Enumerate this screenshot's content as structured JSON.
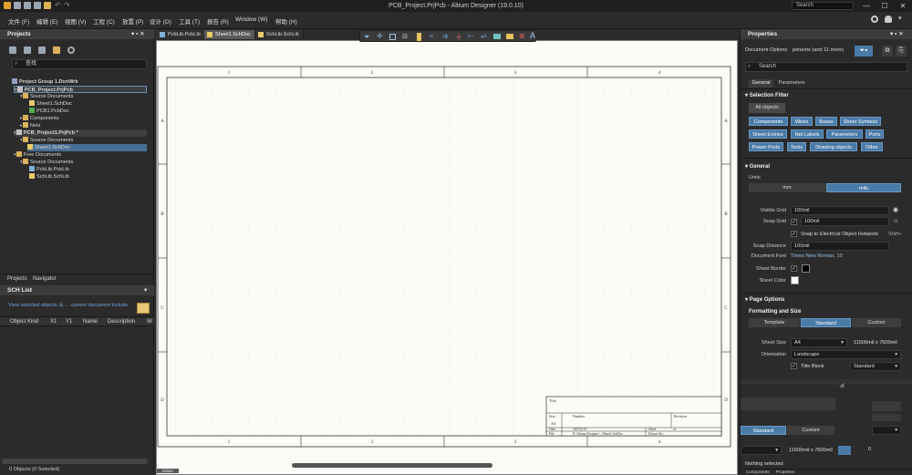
{
  "window": {
    "title": "PCB_Project.PrjPcb - Altium Designer (19.0.10)",
    "search_placeholder": "Search",
    "minimize": "—",
    "maximize": "☐",
    "close": "✕"
  },
  "menu": {
    "items": [
      "文件 (F)",
      "编辑 (E)",
      "视图 (V)",
      "工程 (C)",
      "放置 (P)",
      "设计 (D)",
      "工具 (T)",
      "报告 (R)",
      "Window (W)",
      "帮助 (H)"
    ]
  },
  "projects_panel": {
    "title": "Projects",
    "search_placeholder": "查找",
    "tree": [
      {
        "label": "Project Group 1.DsnWrk",
        "icon": "workspace"
      },
      {
        "label": "PCB_Project.PrjPcb",
        "icon": "project"
      },
      {
        "label": "Source Documents",
        "icon": "folder"
      },
      {
        "label": "Sheet1.SchDoc",
        "icon": "schdoc"
      },
      {
        "label": "PCB1.PcbDoc",
        "icon": "pcbdoc"
      },
      {
        "label": "Components",
        "icon": "folder"
      },
      {
        "label": "Nets",
        "icon": "folder"
      },
      {
        "label": "PCB_Project1.PrjPcb *",
        "icon": "project"
      },
      {
        "label": "Source Documents",
        "icon": "folder"
      },
      {
        "label": "Sheet1.SchDoc",
        "icon": "schdoc"
      },
      {
        "label": "Free Documents",
        "icon": "folder"
      },
      {
        "label": "Source Documents",
        "icon": "folder"
      },
      {
        "label": "PcbLib.PcbLib",
        "icon": "pcblib"
      },
      {
        "label": "SchLib.SchLib",
        "icon": "schlib"
      }
    ],
    "bottom_tabs": [
      "Projects",
      "Navigator"
    ]
  },
  "sch_list": {
    "title": "SCH List",
    "info": "View selected objects 从 ... current document include",
    "columns": [
      "Object Kind",
      "X1",
      "Y1",
      "Name",
      "Description",
      "W"
    ],
    "status": "0 Objects (0 Selected)"
  },
  "tabs": [
    "PcbLib.PcbLib",
    "Sheet1.SchDoc",
    "SchLib.SchLib"
  ],
  "sheet": {
    "col_labels": [
      "1",
      "2",
      "3",
      "4"
    ],
    "row_labels": [
      "A",
      "B",
      "C",
      "D"
    ],
    "title_block": {
      "title": "Title",
      "size_label": "Size",
      "size_value": "A4",
      "number_label": "Number",
      "revision_label": "Revision",
      "date_label": "Date",
      "date_value": "2019/2/18",
      "file_label": "File",
      "file_value": "E:\\Altium Designer\\...\\Sheet1.SchDoc",
      "sheet_label": "Sheet",
      "of_label": "of",
      "drawn_label": "Drawn By:"
    },
    "editor_tab": "Editor"
  },
  "properties": {
    "title": "Properties",
    "doc_options": "Document Options",
    "doc_options_filter": "ponents (and 11 more)",
    "search_placeholder": "Search",
    "tabs": [
      "General",
      "Parameters"
    ],
    "selection_filter_title": "Selection Filter",
    "all_objects": "All objects",
    "filter_buttons": [
      "Components",
      "Wires",
      "Buses",
      "Sheet Symbols",
      "Sheet Entries",
      "Net Labels",
      "Parameters",
      "Ports",
      "Power Ports",
      "Texts",
      "Drawing objects",
      "Other"
    ],
    "general_title": "General",
    "units_label": "Units",
    "unit_mm": "mm",
    "unit_mils": "mils",
    "visible_grid_label": "Visible Grid",
    "visible_grid_value": "100mil",
    "snap_grid_label": "Snap Grid",
    "snap_grid_value": "100mil",
    "snap_grid_key": "G",
    "snap_hotspots": "Snap to Electrical Object Hotspots",
    "snap_hotspots_key": "Shift+",
    "snap_distance_label": "Snap Distance",
    "snap_distance_value": "100mil",
    "doc_font_label": "Document Font",
    "doc_font_value": "Times New Roman, 10",
    "sheet_border_label": "Sheet Border",
    "sheet_color_label": "Sheet Color",
    "page_options_title": "Page Options",
    "formatting_title": "Formatting and Size",
    "format_template": "Template",
    "format_standard": "Standard",
    "format_custom": "Custom",
    "sheet_size_label": "Sheet Size",
    "sheet_size_value": "A4",
    "sheet_size_dims": "11500mil x 7600mil",
    "orientation_label": "Orientation",
    "orientation_value": "Landscape",
    "title_block_label": "Title Block",
    "title_block_value": "Standard",
    "overlay_standard": "Standard",
    "overlay_custom": "Custom",
    "overlay_dims": "11500mil x 7600mil",
    "overlay_value": "0",
    "nothing_selected": "Nothing selected",
    "bottom_tabs": [
      "Components",
      "Properties"
    ]
  },
  "colors": {
    "accent": "#4a7ba7",
    "selection": "#4a6f95",
    "sheet_border_swatch": "#000000",
    "sheet_color_swatch": "#ffffff"
  }
}
